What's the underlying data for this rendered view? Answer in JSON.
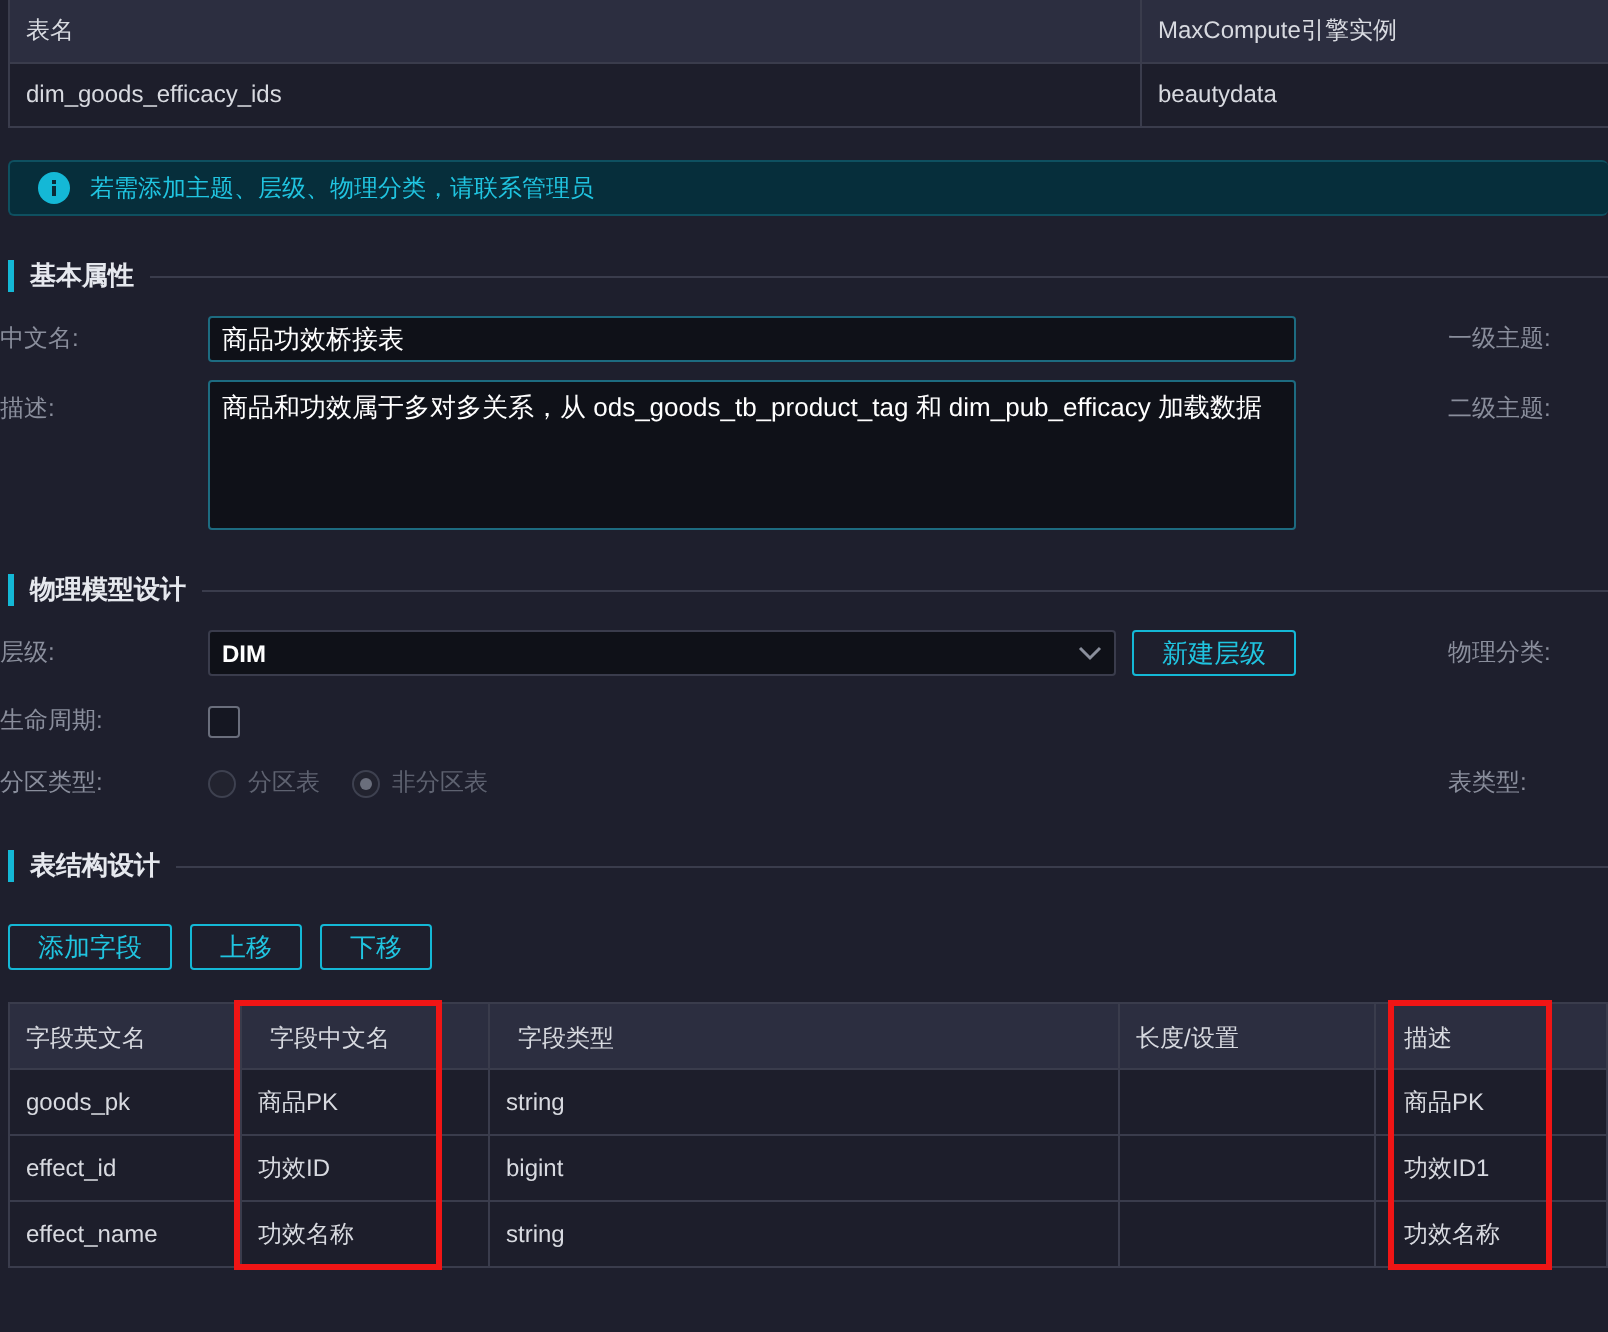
{
  "info_table": {
    "columns": [
      "表名",
      "MaxCompute引擎实例"
    ],
    "row": [
      "dim_goods_efficacy_ids",
      "beautydata"
    ]
  },
  "notice": "若需添加主题、层级、物理分类，请联系管理员",
  "basic": {
    "heading": "基本属性",
    "name_label": "中文名:",
    "name_value": "商品功效桥接表",
    "theme1_label": "一级主题:",
    "desc_label": "描述:",
    "desc_value": "商品和功效属于多对多关系，从 ods_goods_tb_product_tag 和 dim_pub_efficacy 加载数据",
    "theme2_label": "二级主题:"
  },
  "physical": {
    "heading": "物理模型设计",
    "level_label": "层级:",
    "level_value": "DIM",
    "new_level_button": "新建层级",
    "category_label": "物理分类:",
    "lifecycle_label": "生命周期:",
    "lifecycle_checked": false,
    "partition_label": "分区类型:",
    "table_type_label": "表类型:",
    "partition_options": [
      {
        "label": "分区表",
        "selected": false,
        "disabled": true
      },
      {
        "label": "非分区表",
        "selected": true,
        "disabled": true
      }
    ]
  },
  "structure": {
    "heading": "表结构设计",
    "buttons": [
      "添加字段",
      "上移",
      "下移"
    ],
    "columns": [
      {
        "label": "字段英文名",
        "highlighted": false
      },
      {
        "label": "字段中文名",
        "highlighted": true
      },
      {
        "label": "字段类型",
        "highlighted": false
      },
      {
        "label": "长度/设置",
        "highlighted": false
      },
      {
        "label": "描述",
        "highlighted": true
      }
    ],
    "rows": [
      [
        "goods_pk",
        "商品PK",
        "string",
        "",
        "商品PK"
      ],
      [
        "effect_id",
        "功效ID",
        "bigint",
        "",
        "功效ID1"
      ],
      [
        "effect_name",
        "功效名称",
        "string",
        "",
        "功效名称"
      ]
    ]
  }
}
